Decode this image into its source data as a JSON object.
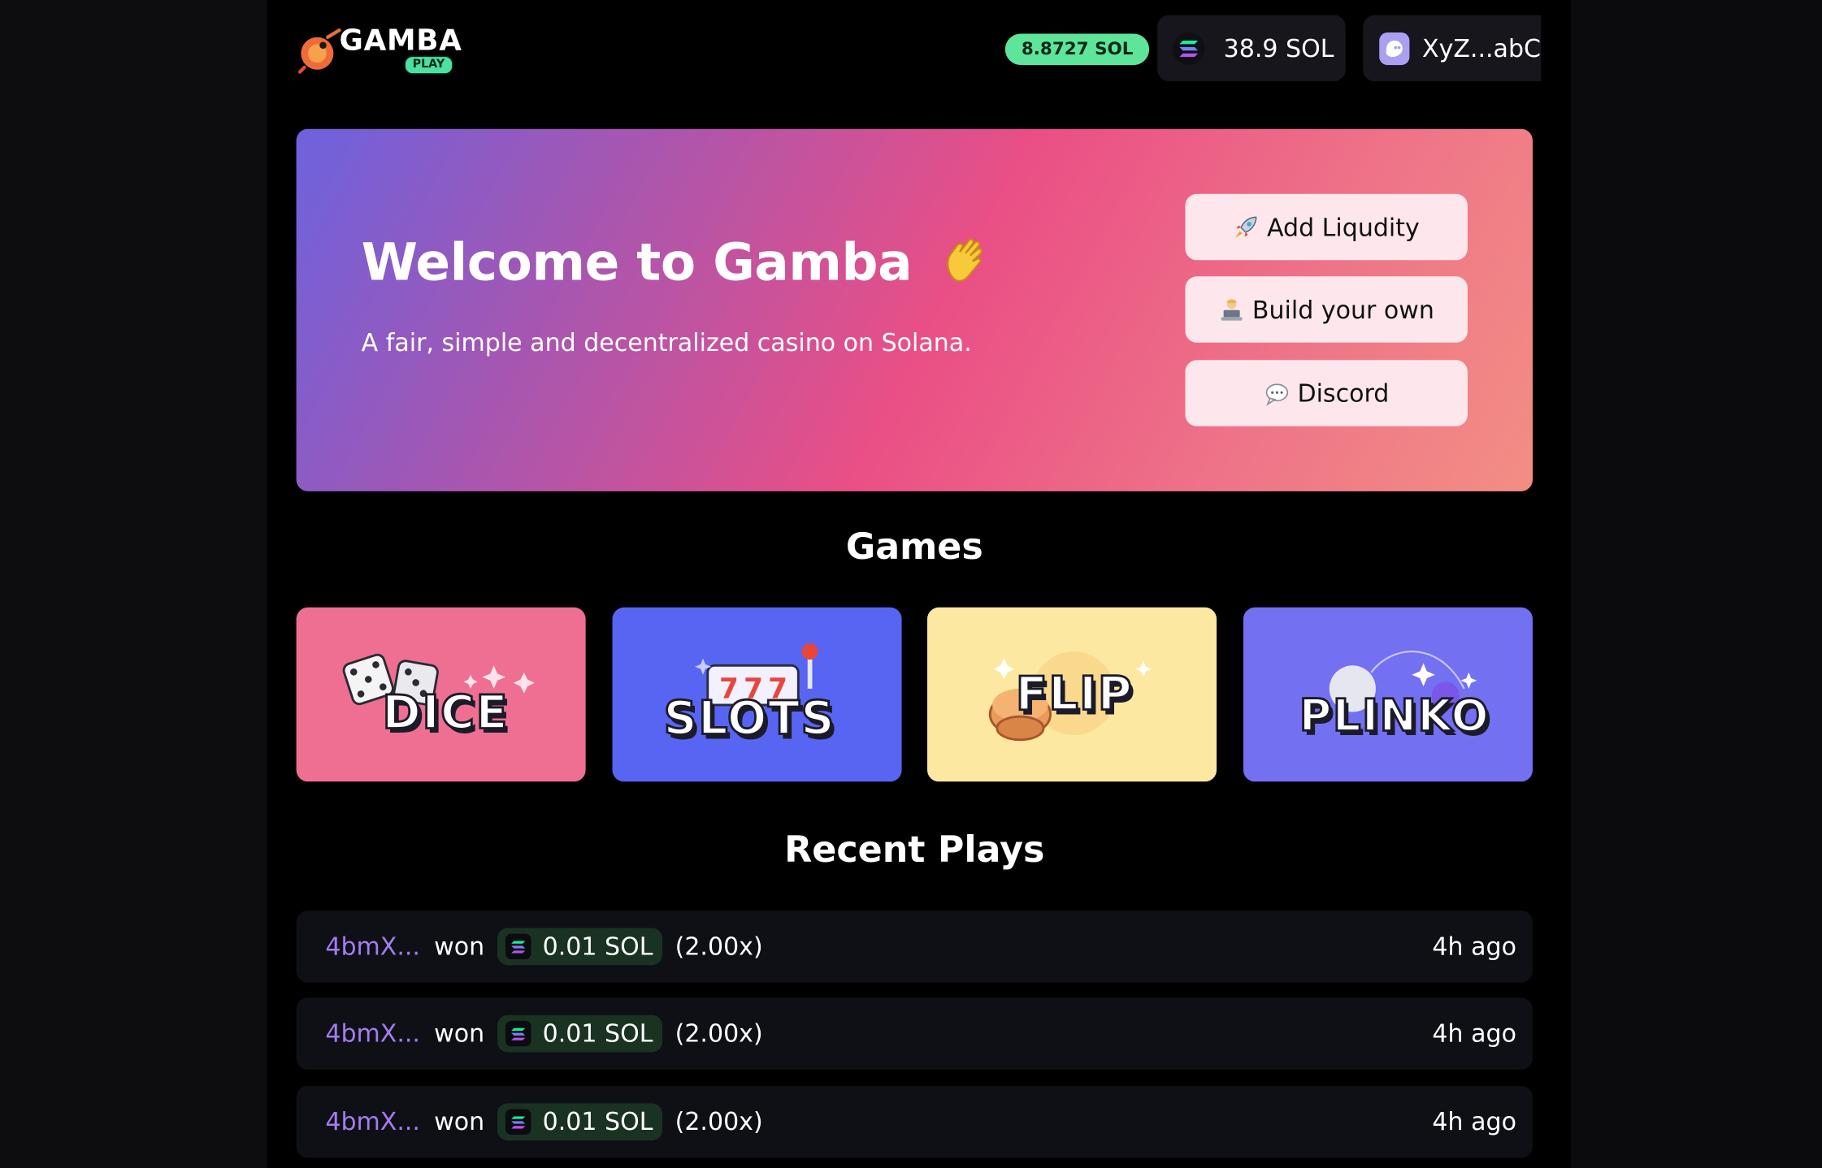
{
  "header": {
    "logo_text": "GAMBA",
    "logo_badge": "PLAY",
    "pool_balance": "8.8727 SOL",
    "wallet_balance": "38.9 SOL",
    "wallet_address": "XyZ...abC"
  },
  "hero": {
    "title": "Welcome to Gamba",
    "subtitle": "A fair, simple and decentralized casino on Solana.",
    "buttons": [
      {
        "label": "Add Liqudity",
        "icon": "rocket-icon"
      },
      {
        "label": "Build your own",
        "icon": "technologist-icon"
      },
      {
        "label": "Discord",
        "icon": "speech-bubble-icon"
      }
    ]
  },
  "games": {
    "title": "Games",
    "cards": [
      {
        "label": "DICE",
        "color": "#ee6f92"
      },
      {
        "label": "SLOTS",
        "color": "#5865f2"
      },
      {
        "label": "FLIP",
        "color": "#fce8a0"
      },
      {
        "label": "PLINKO",
        "color": "#7470f2"
      }
    ]
  },
  "recent": {
    "title": "Recent Plays",
    "rows": [
      {
        "player": "4bmX...",
        "verb": "won",
        "amount": "0.01 SOL",
        "multiplier": "(2.00x)",
        "time": "4h ago"
      },
      {
        "player": "4bmX...",
        "verb": "won",
        "amount": "0.01 SOL",
        "multiplier": "(2.00x)",
        "time": "4h ago"
      },
      {
        "player": "4bmX...",
        "verb": "won",
        "amount": "0.01 SOL",
        "multiplier": "(2.00x)",
        "time": "4h ago"
      }
    ]
  },
  "colors": {
    "accent_green": "#5ee59a",
    "player_purple": "#a57cf0",
    "hero_gradient_start": "#6d62de",
    "hero_gradient_mid": "#ea4f85",
    "hero_gradient_end": "#f38e84"
  }
}
